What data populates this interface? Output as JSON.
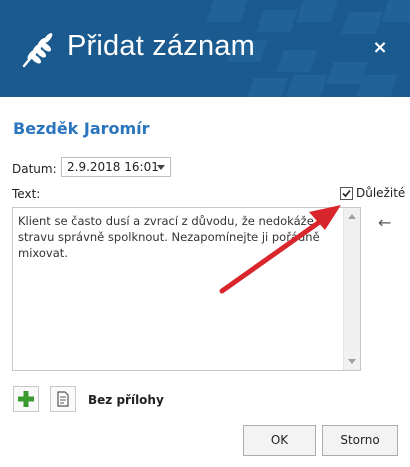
{
  "header": {
    "title": "Přidat záznam",
    "close_label": "×",
    "logo_icon": "wheat-icon"
  },
  "patient": {
    "name": "Bezděk Jaromír"
  },
  "form": {
    "date_label": "Datum:",
    "date_value": "2.9.2018 16:01",
    "text_label": "Text:",
    "important_label": "Důležité",
    "important_checked": true,
    "text_value": "Klient se často dusí a zvrací z důvodu, že nedokáže stravu správně spolknout. Nezapomínejte ji pořádně mixovat."
  },
  "attachments": {
    "label": "Bez přílohy",
    "add_icon": "plus-icon",
    "list_icon": "document-icon"
  },
  "buttons": {
    "ok": "OK",
    "cancel": "Storno"
  },
  "colors": {
    "header": "#1b5a8e",
    "name": "#2a75bd",
    "arrow": "#d9262c",
    "add": "#3a9a2f"
  }
}
